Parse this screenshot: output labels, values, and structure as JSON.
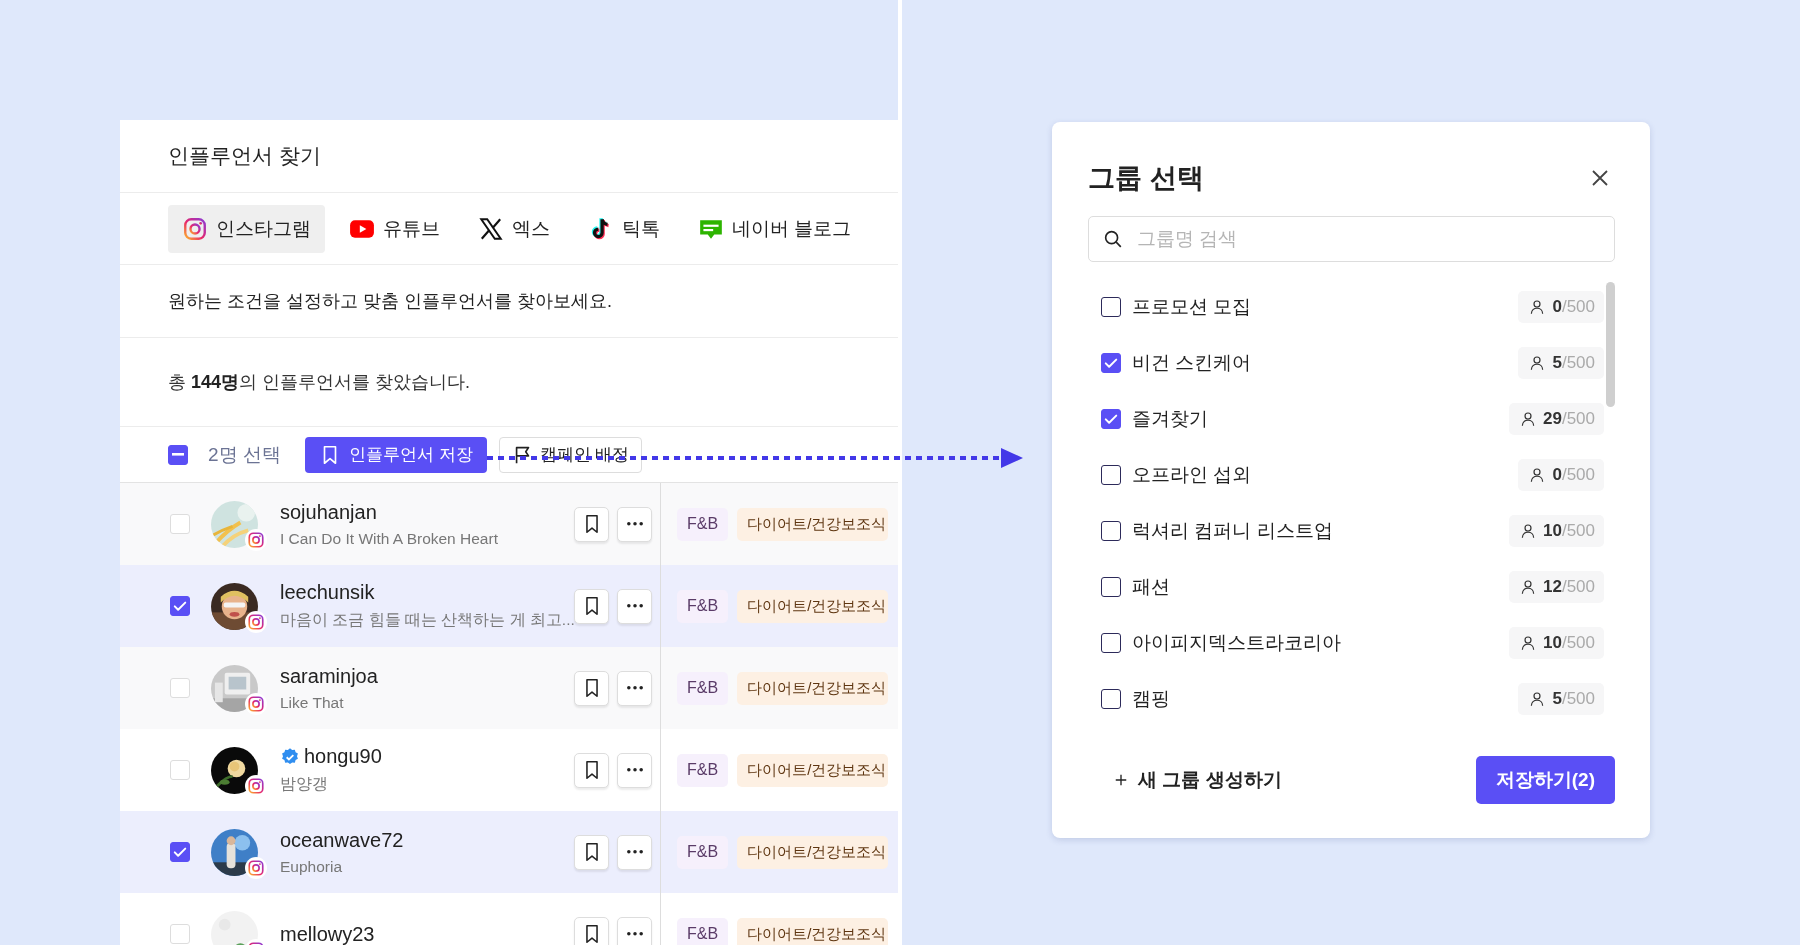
{
  "page_title": "인플루언서 찾기",
  "platform_tabs": [
    {
      "label": "인스타그램",
      "kind": "instagram",
      "selected": true
    },
    {
      "label": "유튜브",
      "kind": "youtube",
      "selected": false
    },
    {
      "label": "엑스",
      "kind": "x",
      "selected": false
    },
    {
      "label": "틱톡",
      "kind": "tiktok",
      "selected": false
    },
    {
      "label": "네이버 블로그",
      "kind": "naver_blog",
      "selected": false
    }
  ],
  "description": "원하는 조건을 설정하고 맞춤 인플루언서를 찾아보세요.",
  "result_summary": "총 **144명**의 인플루언서를 찾았습니다.",
  "toolbar": {
    "select_all_indeterminate": true,
    "selection_count": "2명 선택",
    "save_button": "인플루언서 저장",
    "campaign_button": "캠페인 배정"
  },
  "influencers": [
    {
      "name": "sojuhanjan",
      "bio": "I Can Do It With A Broken Heart",
      "checked": false,
      "verified": false,
      "tags": [
        {
          "label": "F&B",
          "kind": "category"
        },
        {
          "label": "다이어트/건강보조식",
          "kind": "subcategory"
        }
      ]
    },
    {
      "name": "leechunsik",
      "bio": "마음이 조금 힘들 때는 산책하는 게 최고...",
      "checked": true,
      "verified": false,
      "tags": [
        {
          "label": "F&B",
          "kind": "category"
        },
        {
          "label": "다이어트/건강보조식",
          "kind": "subcategory"
        }
      ]
    },
    {
      "name": "saraminjoa",
      "bio": "Like That",
      "checked": false,
      "verified": false,
      "tags": [
        {
          "label": "F&B",
          "kind": "category"
        },
        {
          "label": "다이어트/건강보조식",
          "kind": "subcategory"
        }
      ]
    },
    {
      "name": "hongu90",
      "bio": "밤양갱",
      "checked": false,
      "verified": true,
      "tags": [
        {
          "label": "F&B",
          "kind": "category"
        },
        {
          "label": "다이어트/건강보조식",
          "kind": "subcategory"
        }
      ]
    },
    {
      "name": "oceanwave72",
      "bio": "Euphoria",
      "checked": true,
      "verified": false,
      "tags": [
        {
          "label": "F&B",
          "kind": "category"
        },
        {
          "label": "다이어트/건강보조식",
          "kind": "subcategory"
        }
      ]
    },
    {
      "name": "mellowy23",
      "checked": false,
      "verified": false,
      "tags": [
        {
          "label": "F&B",
          "kind": "category"
        },
        {
          "label": "다이어트/건강보조식",
          "kind": "subcategory"
        }
      ]
    }
  ],
  "group_dialog": {
    "title": "그룹 선택",
    "search": {
      "placeholder": "그룹명 검색"
    },
    "groups": [
      {
        "name": "프로모션 모집",
        "checked": false,
        "count": "0",
        "capacity": "/500"
      },
      {
        "name": "비건 스킨케어",
        "checked": true,
        "count": "5",
        "capacity": "/500"
      },
      {
        "name": "즐겨찾기",
        "checked": true,
        "count": "29",
        "capacity": "/500"
      },
      {
        "name": "오프라인 섭외",
        "checked": false,
        "count": "0",
        "capacity": "/500"
      },
      {
        "name": "럭셔리 컴퍼니 리스트업",
        "checked": false,
        "count": "10",
        "capacity": "/500"
      },
      {
        "name": "패션",
        "checked": false,
        "count": "12",
        "capacity": "/500"
      },
      {
        "name": "아이피지덱스트라코리아",
        "checked": false,
        "count": "10",
        "capacity": "/500"
      },
      {
        "name": "캠핑",
        "checked": false,
        "count": "5",
        "capacity": "/500"
      }
    ],
    "new_group_button": "새 그룹 생성하기",
    "save_button": "저장하기(2)"
  }
}
